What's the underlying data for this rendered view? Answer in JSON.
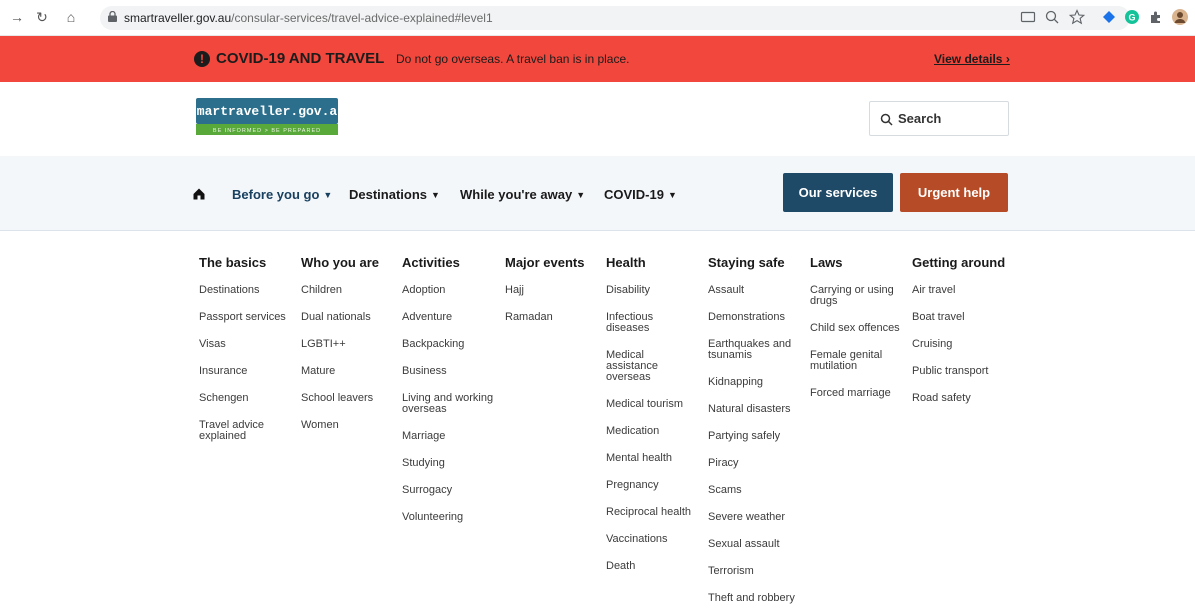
{
  "browser": {
    "url_host": "smartraveller.gov.au",
    "url_path": "/consular-services/travel-advice-explained#level1"
  },
  "covid_banner": {
    "title": "COVID-19 AND TRAVEL",
    "message": "Do not go overseas. A travel ban is in place.",
    "link": "View details ›"
  },
  "header": {
    "logo_text": "smartraveller.gov.au",
    "logo_tagline": "BE INFORMED > BE PREPARED",
    "search_placeholder": "Search"
  },
  "nav": {
    "items": [
      {
        "label": "Before you go"
      },
      {
        "label": "Destinations"
      },
      {
        "label": "While you're away"
      },
      {
        "label": "COVID-19"
      }
    ],
    "services_label": "Our services",
    "urgent_label": "Urgent help"
  },
  "menu": {
    "columns": [
      {
        "heading": "The basics",
        "items": [
          "Destinations",
          "Passport services",
          "Visas",
          "Insurance",
          "Schengen",
          "Travel advice explained"
        ]
      },
      {
        "heading": "Who you are",
        "items": [
          "Children",
          "Dual nationals",
          "LGBTI++",
          "Mature",
          "School leavers",
          "Women"
        ]
      },
      {
        "heading": "Activities",
        "items": [
          "Adoption",
          "Adventure",
          "Backpacking",
          "Business",
          "Living and working overseas",
          "Marriage",
          "Studying",
          "Surrogacy",
          "Volunteering"
        ]
      },
      {
        "heading": "Major events",
        "items": [
          "Hajj",
          "Ramadan"
        ]
      },
      {
        "heading": "Health",
        "items": [
          "Disability",
          "Infectious diseases",
          "Medical assistance overseas",
          "Medical tourism",
          "Medication",
          "Mental health",
          "Pregnancy",
          "Reciprocal health",
          "Vaccinations",
          "Death"
        ]
      },
      {
        "heading": "Staying safe",
        "items": [
          "Assault",
          "Demonstrations",
          "Earthquakes and tsunamis",
          "Kidnapping",
          "Natural disasters",
          "Partying safely",
          "Piracy",
          "Scams",
          "Severe weather",
          "Sexual assault",
          "Terrorism",
          "Theft and robbery"
        ]
      },
      {
        "heading": "Laws",
        "items": [
          "Carrying or using drugs",
          "Child sex offences",
          "Female genital mutilation",
          "Forced marriage"
        ]
      },
      {
        "heading": "Getting around",
        "items": [
          "Air travel",
          "Boat travel",
          "Cruising",
          "Public transport",
          "Road safety"
        ]
      }
    ]
  },
  "colors": {
    "covid_banner": "#f2473c",
    "services_button": "#1e4a67",
    "urgent_button": "#b64c27",
    "nav_background": "#f4f7fa"
  }
}
